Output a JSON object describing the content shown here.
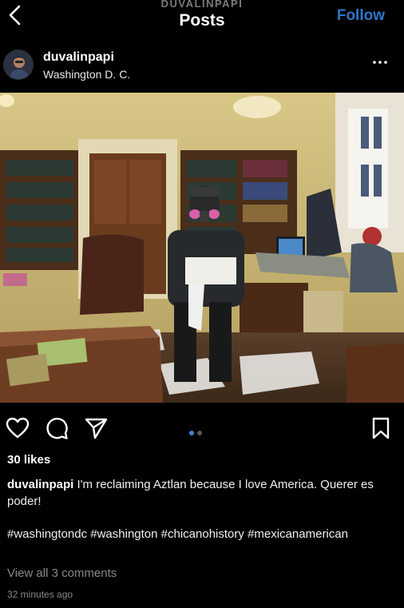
{
  "header": {
    "account_name": "DUVALINPAPI",
    "title": "Posts",
    "follow_label": "Follow",
    "back_icon": "chevron-left-icon"
  },
  "post": {
    "username": "duvalinpapi",
    "location": "Washington D. C.",
    "more_icon": "more-horizontal-icon",
    "photo_alt": "Photo",
    "likes": "30 likes",
    "caption_text": " I'm reclaiming Aztlan because I love America. Querer es poder!",
    "hashtags": [
      "#washingtondc",
      "#washington",
      "#chicanohistory",
      "#mexicanamerican"
    ],
    "view_comments": "View all 3 comments",
    "timestamp": "32 minutes ago",
    "carousel": {
      "count": 2,
      "active": 0
    }
  },
  "colors": {
    "background": "#000000",
    "follow_blue": "#2c77c8",
    "active_dot": "#3a86d6",
    "inactive_dot": "#5a5a5a",
    "muted_text": "#8a8a8a"
  },
  "icons": {
    "like": "heart-icon",
    "comment": "comment-icon",
    "share": "send-icon",
    "save": "bookmark-icon"
  }
}
